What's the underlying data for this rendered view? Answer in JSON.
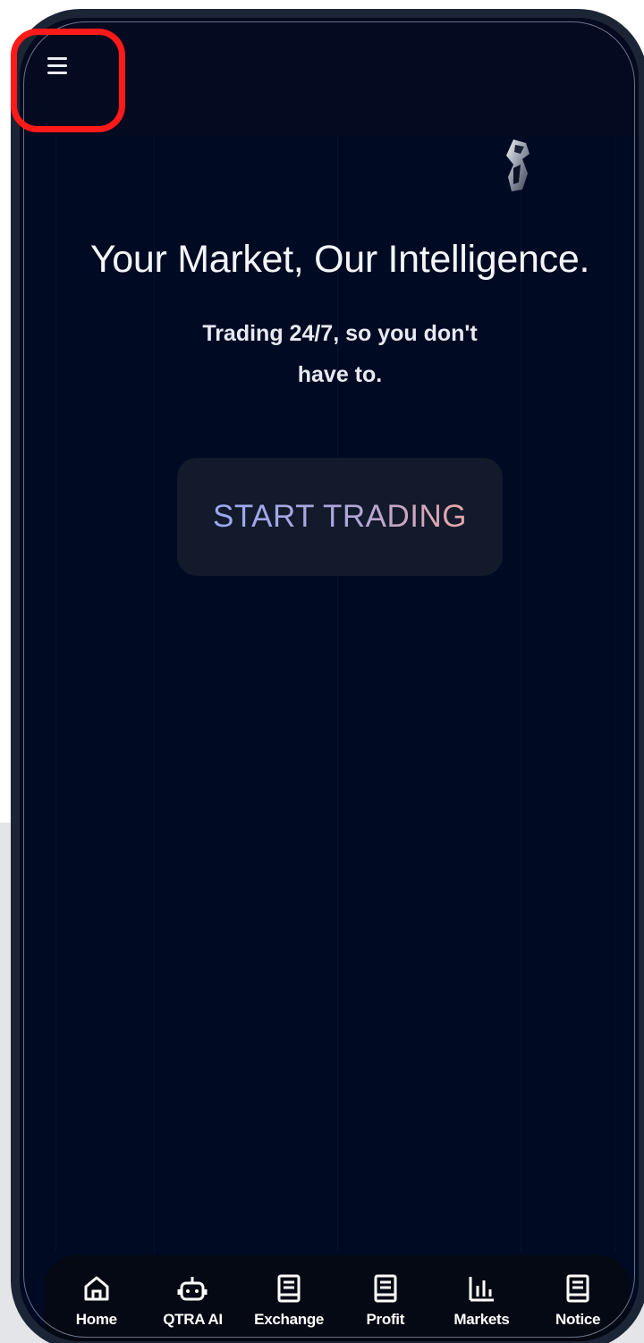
{
  "hero": {
    "headline": "Your Market, Our Intelligence.",
    "subline": "Trading 24/7, so you don't have to.",
    "cta_label": "START TRADING"
  },
  "header": {
    "menu_icon": "hamburger-menu-icon",
    "logo_icon": "brand-logo-icon"
  },
  "bottom_nav": {
    "items": [
      {
        "label": "Home",
        "icon": "home-icon"
      },
      {
        "label": "QTRA AI",
        "icon": "robot-icon"
      },
      {
        "label": "Exchange",
        "icon": "book-icon"
      },
      {
        "label": "Profit",
        "icon": "book-icon"
      },
      {
        "label": "Markets",
        "icon": "bar-chart-icon"
      },
      {
        "label": "Notice",
        "icon": "book-icon"
      }
    ]
  },
  "colors": {
    "background": "#000a22",
    "frame": "#1c2535",
    "highlight": "#ff1a1a",
    "cta_background": "#121a2c"
  }
}
